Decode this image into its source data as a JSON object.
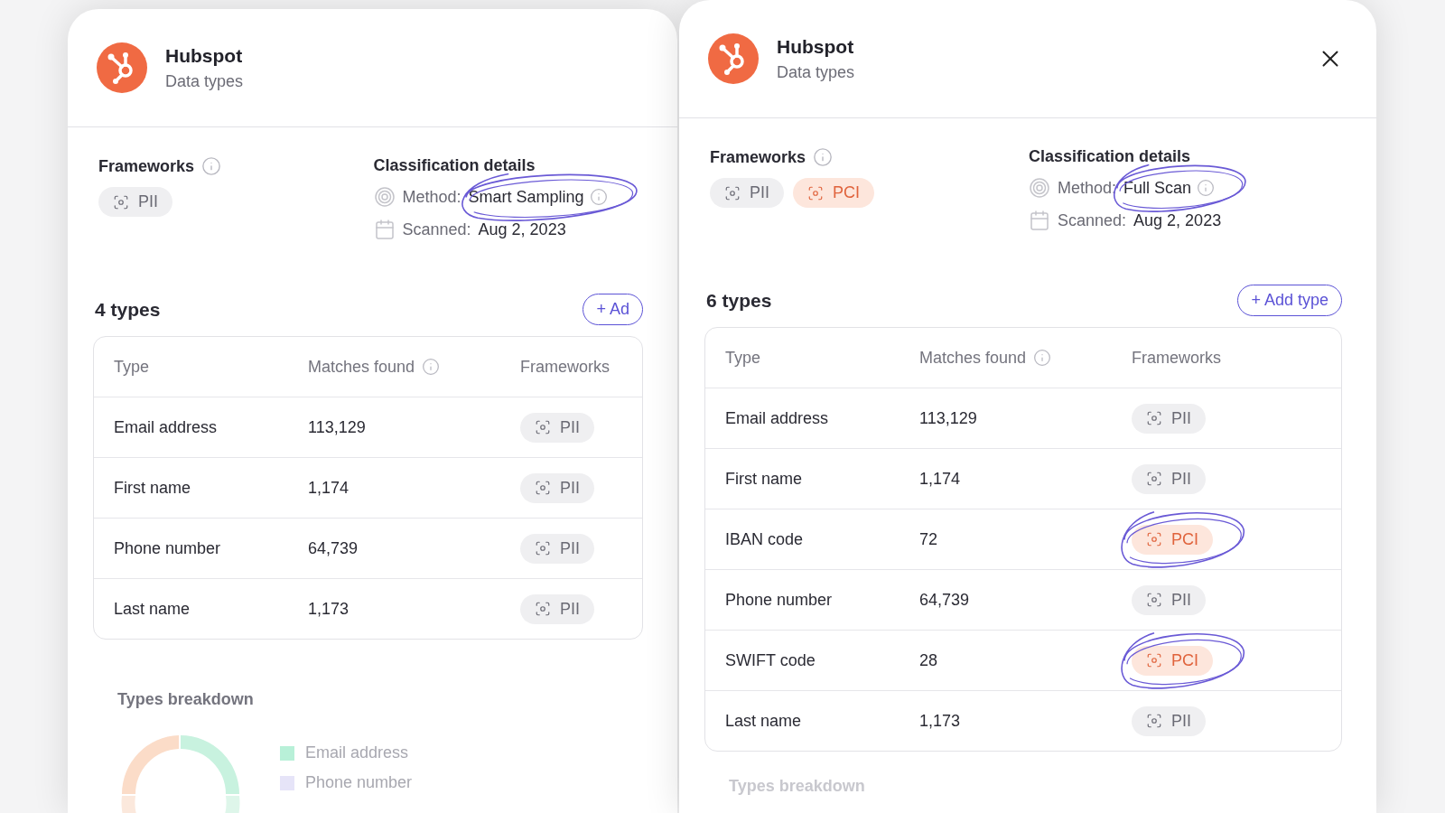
{
  "panels": [
    {
      "title": "Hubspot",
      "subtitle": "Data types",
      "closable": false,
      "frameworks": {
        "label": "Frameworks",
        "items": [
          {
            "label": "PII",
            "kind": "pii"
          }
        ]
      },
      "classification": {
        "title": "Classification details",
        "method_label": "Method:",
        "method_value": "Smart Sampling",
        "method_circled": true,
        "scanned_label": "Scanned:",
        "scanned_value": "Aug 2, 2023"
      },
      "count": "4 types",
      "add_label": "+ Ad",
      "columns": [
        "Type",
        "Matches found",
        "Frameworks"
      ],
      "rows": [
        {
          "type": "Email address",
          "matches": "113,129",
          "framework": {
            "label": "PII",
            "kind": "pii",
            "circled": false
          }
        },
        {
          "type": "First name",
          "matches": "1,174",
          "framework": {
            "label": "PII",
            "kind": "pii",
            "circled": false
          }
        },
        {
          "type": "Phone number",
          "matches": "64,739",
          "framework": {
            "label": "PII",
            "kind": "pii",
            "circled": false
          }
        },
        {
          "type": "Last name",
          "matches": "1,173",
          "framework": {
            "label": "PII",
            "kind": "pii",
            "circled": false
          }
        }
      ],
      "breakdown": {
        "title": "Types breakdown",
        "legend": [
          {
            "label": "Email address",
            "color": "#b8f0d8"
          },
          {
            "label": "Phone number",
            "color": "#e6e4f8"
          }
        ]
      }
    },
    {
      "title": "Hubspot",
      "subtitle": "Data types",
      "closable": true,
      "frameworks": {
        "label": "Frameworks",
        "items": [
          {
            "label": "PII",
            "kind": "pii"
          },
          {
            "label": "PCI",
            "kind": "pci"
          }
        ]
      },
      "classification": {
        "title": "Classification details",
        "method_label": "Method:",
        "method_value": "Full Scan",
        "method_circled": true,
        "scanned_label": "Scanned:",
        "scanned_value": "Aug 2, 2023"
      },
      "count": "6 types",
      "add_label": "+ Add type",
      "columns": [
        "Type",
        "Matches found",
        "Frameworks"
      ],
      "rows": [
        {
          "type": "Email address",
          "matches": "113,129",
          "framework": {
            "label": "PII",
            "kind": "pii",
            "circled": false
          }
        },
        {
          "type": "First name",
          "matches": "1,174",
          "framework": {
            "label": "PII",
            "kind": "pii",
            "circled": false
          }
        },
        {
          "type": "IBAN code",
          "matches": "72",
          "framework": {
            "label": "PCI",
            "kind": "pci",
            "circled": true
          }
        },
        {
          "type": "Phone number",
          "matches": "64,739",
          "framework": {
            "label": "PII",
            "kind": "pii",
            "circled": false
          }
        },
        {
          "type": "SWIFT code",
          "matches": "28",
          "framework": {
            "label": "PCI",
            "kind": "pci",
            "circled": true
          }
        },
        {
          "type": "Last name",
          "matches": "1,173",
          "framework": {
            "label": "PII",
            "kind": "pii",
            "circled": false
          }
        }
      ],
      "breakdown": {
        "title": "Types breakdown"
      }
    }
  ]
}
